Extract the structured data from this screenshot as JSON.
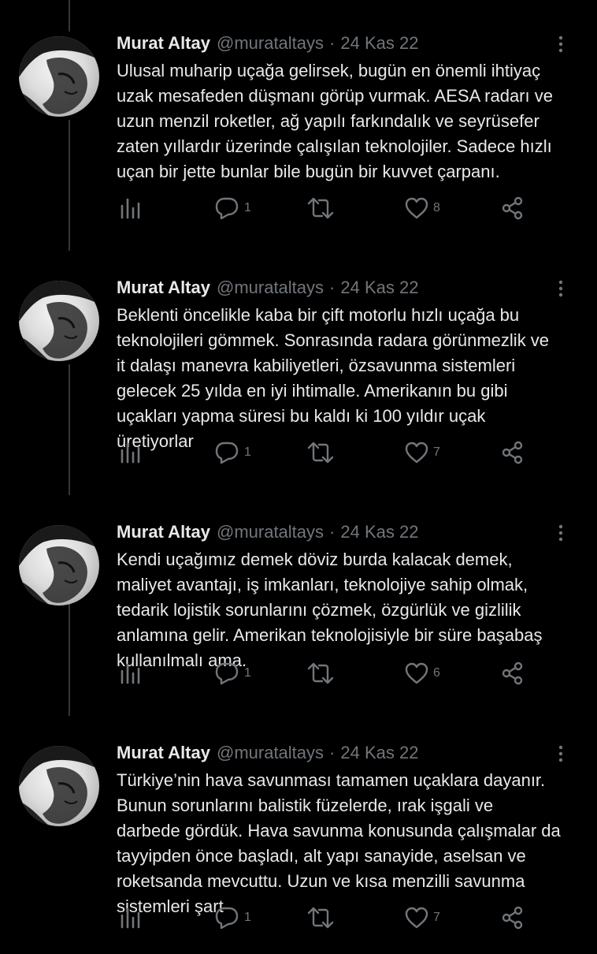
{
  "tweets": [
    {
      "name": "Murat Altay",
      "handle": "@murataltays",
      "separator": "·",
      "date": "24 Kas 22",
      "lines": [
        "Ulusal muharip uçağa gelirsek, bugün en önemli ihtiyaç",
        "uzak mesafeden düşmanı görüp vurmak. AESA radarı ve",
        "uzun menzil roketler, ağ yapılı farkındalık ve seyrüsefer",
        "zaten yıllardır üzerinde çalışılan teknolojiler. Sadece hızlı",
        "uçan bir jette bunlar bile bugün bir kuvvet çarpanı."
      ],
      "replies": "1",
      "retweets": "",
      "likes": "8"
    },
    {
      "name": "Murat Altay",
      "handle": "@murataltays",
      "separator": "·",
      "date": "24 Kas 22",
      "lines": [
        "Beklenti öncelikle kaba bir çift motorlu hızlı uçağa bu",
        "teknolojileri gömmek. Sonrasında radara görünmezlik ve",
        "it dalaşı manevra kabiliyetleri, özsavunma sistemleri",
        "gelecek 25 yılda en iyi ihtimalle. Amerikanın bu gibi",
        "uçakları yapma süresi bu kaldı ki 100 yıldır uçak",
        "üretiyorlar"
      ],
      "replies": "1",
      "retweets": "",
      "likes": "7"
    },
    {
      "name": "Murat Altay",
      "handle": "@murataltays",
      "separator": "·",
      "date": "24 Kas 22",
      "lines": [
        "Kendi uçağımız demek döviz burda kalacak demek,",
        "maliyet avantajı, iş imkanları, teknolojiye sahip olmak,",
        "tedarik lojistik sorunlarını çözmek, özgürlük ve gizlilik",
        "anlamına gelir. Amerikan teknolojisiyle bir süre başabaş",
        "kullanılmalı ama."
      ],
      "replies": "1",
      "retweets": "",
      "likes": "6"
    },
    {
      "name": "Murat Altay",
      "handle": "@murataltays",
      "separator": "·",
      "date": "24 Kas 22",
      "lines": [
        "Türkiye’nin hava savunması tamamen uçaklara dayanır.",
        "Bunun sorunlarını balistik füzelerde, ırak işgali ve",
        "darbede gördük. Hava savunma konusunda çalışmalar da",
        "tayyipden önce başladı, alt yapı sanayide, aselsan ve",
        "roketsanda mevcuttu. Uzun ve kısa menzilli savunma",
        "sistemleri şart"
      ],
      "replies": "1",
      "retweets": "",
      "likes": "7"
    }
  ],
  "icons": {
    "views": "bar-chart-icon",
    "reply": "reply-bubble-icon",
    "retweet": "retweet-icon",
    "like": "heart-icon",
    "share": "share-icon",
    "more": "more-dots-icon"
  },
  "colors": {
    "background": "#000000",
    "text": "#e7e9ea",
    "secondary": "#71767b",
    "thread_line": "#333639"
  }
}
